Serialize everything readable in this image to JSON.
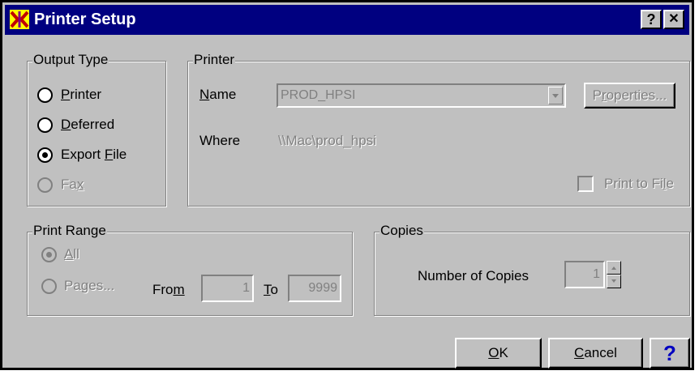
{
  "window": {
    "title": "Printer Setup",
    "help_btn": "?",
    "close_btn": "✕"
  },
  "output_type": {
    "legend": "Output Type",
    "options": [
      {
        "pre": "",
        "u": "P",
        "post": "rinter",
        "selected": false,
        "disabled": false
      },
      {
        "pre": "",
        "u": "D",
        "post": "eferred",
        "selected": false,
        "disabled": false
      },
      {
        "pre": "Export ",
        "u": "F",
        "post": "ile",
        "selected": true,
        "disabled": false
      },
      {
        "pre": "Fa",
        "u": "x",
        "post": "",
        "selected": false,
        "disabled": true
      }
    ]
  },
  "printer": {
    "legend": "Printer",
    "name_u": "N",
    "name_rest": "ame",
    "name_value": "PROD_HPSI",
    "properties_u": "r",
    "properties_pre": "P",
    "properties_post": "operties...",
    "where_label": "Where",
    "where_value": "\\\\Mac\\prod_hpsi",
    "print_to_file_pre": "Print to Fi",
    "print_to_file_u": "l",
    "print_to_file_post": "e"
  },
  "print_range": {
    "legend": "Print Range",
    "all_u": "A",
    "all_rest": "ll",
    "pages_label": "Pages...",
    "from_pre": "Fro",
    "from_u": "m",
    "from_value": "1",
    "to_u": "T",
    "to_rest": "o",
    "to_value": "9999"
  },
  "copies": {
    "legend": "Copies",
    "label": "Number of Copies",
    "value": "1"
  },
  "buttons": {
    "ok_u": "O",
    "ok_rest": "K",
    "cancel_u": "C",
    "cancel_rest": "ancel",
    "help": "?"
  },
  "colors": {
    "titlebar": "#000080",
    "face": "#c0c0c0",
    "disabled_text": "#808080",
    "help_blue": "#0000c0"
  }
}
